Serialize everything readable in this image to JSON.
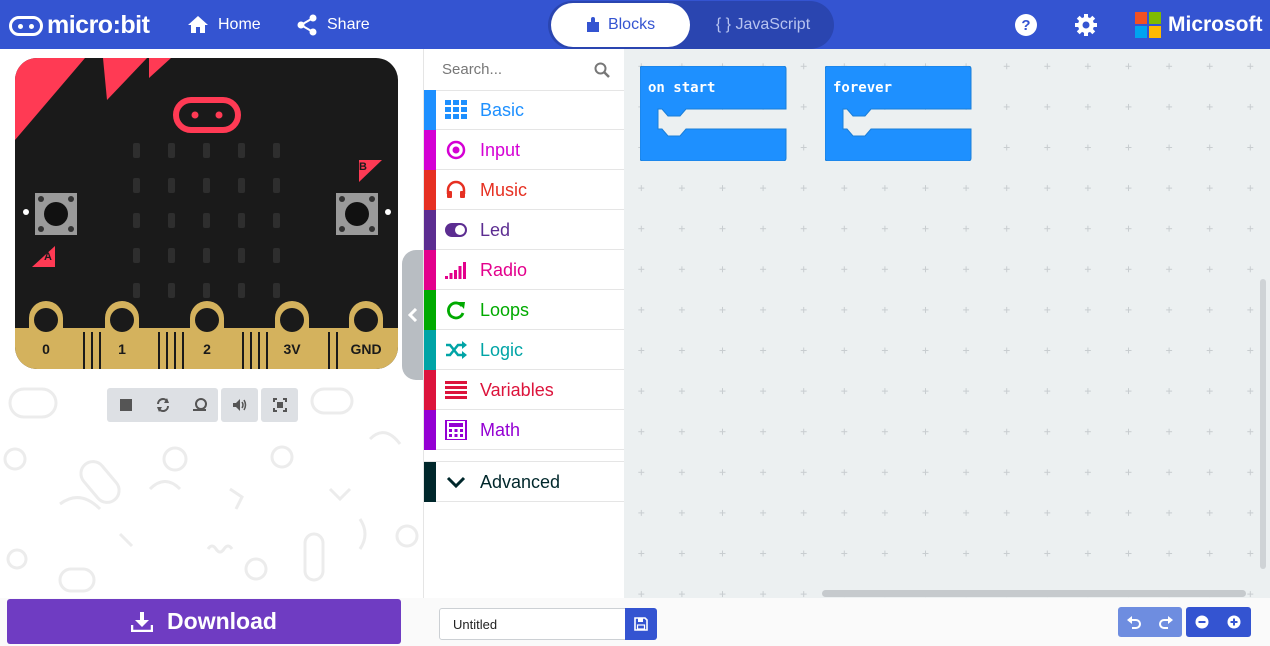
{
  "header": {
    "logo_text": "micro:bit",
    "home_label": "Home",
    "share_label": "Share",
    "blocks_tab": "Blocks",
    "js_tab": "{ } JavaScript",
    "brand": "Microsoft",
    "colors": {
      "bar": "#3454d1",
      "ms_red": "#f25022",
      "ms_green": "#7fba00",
      "ms_blue": "#00a4ef",
      "ms_yellow": "#ffb900"
    }
  },
  "simulator": {
    "buttons": {
      "a": "A",
      "b": "B"
    },
    "pins": [
      "0",
      "1",
      "2",
      "3V",
      "GND"
    ],
    "controls": [
      "stop-icon",
      "restart-icon",
      "slow-motion-icon",
      "sound-icon",
      "fullscreen-icon"
    ]
  },
  "toolbox": {
    "search_placeholder": "Search...",
    "categories": [
      {
        "label": "Basic",
        "color": "#1e90ff",
        "icon": "grid-icon"
      },
      {
        "label": "Input",
        "color": "#d400d4",
        "icon": "target-icon"
      },
      {
        "label": "Music",
        "color": "#e63022",
        "icon": "headphones-icon"
      },
      {
        "label": "Led",
        "color": "#5c2d91",
        "icon": "toggle-icon"
      },
      {
        "label": "Radio",
        "color": "#e3008c",
        "icon": "signal-bars-icon"
      },
      {
        "label": "Loops",
        "color": "#00aa00",
        "icon": "refresh-icon"
      },
      {
        "label": "Logic",
        "color": "#00a4a6",
        "icon": "shuffle-icon"
      },
      {
        "label": "Variables",
        "color": "#dc143c",
        "icon": "list-icon"
      },
      {
        "label": "Math",
        "color": "#9400d3",
        "icon": "calculator-icon"
      }
    ],
    "advanced": {
      "label": "Advanced",
      "color": "#00272b",
      "icon": "chevron-down-icon"
    }
  },
  "workspace": {
    "blocks": [
      {
        "label": "on start",
        "color": "#1e90ff"
      },
      {
        "label": "forever",
        "color": "#1e90ff"
      }
    ]
  },
  "footer": {
    "download_label": "Download",
    "download_color": "#6f3cc2",
    "project_name": "Untitled"
  }
}
